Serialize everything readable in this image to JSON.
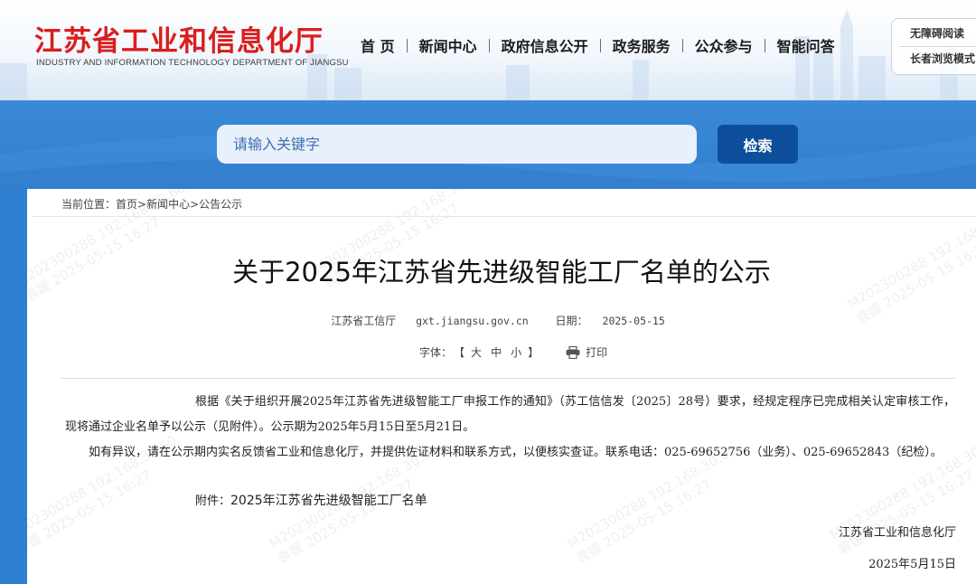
{
  "header": {
    "logo_cn": "江苏省工业和信息化厅",
    "logo_en": "INDUSTRY AND INFORMATION TECHNOLOGY DEPARTMENT OF JIANGSU",
    "nav": [
      "首 页",
      "新闻中心",
      "政府信息公开",
      "政务服务",
      "公众参与",
      "智能问答"
    ],
    "accessibility": {
      "barrier_free": "无障碍阅读",
      "elder_mode": "长者浏览模式"
    }
  },
  "search": {
    "placeholder": "请输入关键字",
    "button_label": "检索"
  },
  "breadcrumb": {
    "prefix": "当前位置：",
    "items": [
      "首页",
      "新闻中心",
      "公告公示"
    ],
    "separator": ">"
  },
  "article": {
    "title": "关于2025年江苏省先进级智能工厂名单的公示",
    "source": "江苏省工信厅",
    "site": "gxt.jiangsu.gov.cn",
    "date_label": "日期：",
    "date": "2025-05-15",
    "font_label": "字体：",
    "font_open": "【",
    "font_sizes": [
      "大",
      "中",
      "小"
    ],
    "font_close": "】",
    "print_label": "打印",
    "paragraph1": "根据《关于组织开展2025年江苏省先进级智能工厂申报工作的通知》（苏工信信发〔2025〕28号）要求，经规定程序已完成相关认定审核工作，现将通过企业名单予以公示（见附件）。公示期为2025年5月15日至5月21日。",
    "paragraph2": "如有异议，请在公示期内实名反馈省工业和信息化厅，并提供佐证材料和联系方式，以便核实查证。联系电话：025-69652756（业务）、025-69652843（纪检）。",
    "attachment_label": "附件：",
    "attachment_name": "2025年江苏省先进级智能工厂名单",
    "signature": "江苏省工业和信息化厅",
    "signature_date": "2025年5月15日"
  },
  "watermark": {
    "line1": "M202300288 192.168.30.60",
    "line2": "袁媛 2025-05-15 16:27"
  },
  "colors": {
    "logo_red": "#d91e1e",
    "band_blue": "#2f7fd0",
    "search_button": "#0d4f9a",
    "search_field": "#e8f0fb"
  },
  "icons": {
    "print": "printer-icon"
  }
}
